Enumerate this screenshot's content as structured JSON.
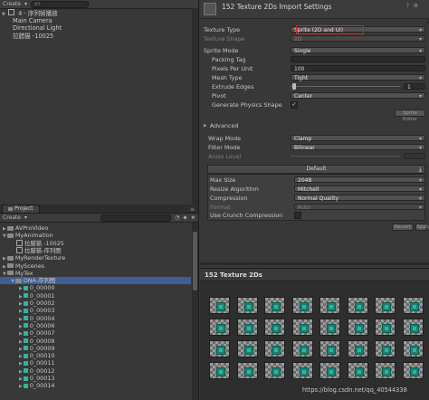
{
  "hierarchy": {
    "create_label": "Create",
    "search_placeholder": "All",
    "scene_name": "4 - 序列帧播放",
    "items": [
      "Main Camera",
      "Directional Light",
      "拉腊猫 -10025"
    ]
  },
  "project": {
    "tab_label": "Project",
    "create_label": "Create",
    "folders": [
      {
        "label": "AVProVideo",
        "indent": 0,
        "kind": "folder"
      },
      {
        "label": "MyAnimation",
        "indent": 0,
        "kind": "folder"
      },
      {
        "label": "拉腊猫 -10025",
        "indent": 1,
        "kind": "asset"
      },
      {
        "label": "拉腊猫-序列图",
        "indent": 1,
        "kind": "asset"
      },
      {
        "label": "MyRenderTexture",
        "indent": 0,
        "kind": "folder"
      },
      {
        "label": "MyScenes",
        "indent": 0,
        "kind": "folder"
      },
      {
        "label": "MyTex",
        "indent": 0,
        "kind": "folder"
      },
      {
        "label": "DNA-序列图",
        "indent": 1,
        "kind": "folder",
        "selected": true
      },
      {
        "label": "0_00000",
        "indent": 2,
        "kind": "sprite"
      },
      {
        "label": "0_00001",
        "indent": 2,
        "kind": "sprite"
      },
      {
        "label": "0_00002",
        "indent": 2,
        "kind": "sprite"
      },
      {
        "label": "0_00003",
        "indent": 2,
        "kind": "sprite"
      },
      {
        "label": "0_00004",
        "indent": 2,
        "kind": "sprite"
      },
      {
        "label": "0_00006",
        "indent": 2,
        "kind": "sprite"
      },
      {
        "label": "0_00007",
        "indent": 2,
        "kind": "sprite"
      },
      {
        "label": "0_00008",
        "indent": 2,
        "kind": "sprite"
      },
      {
        "label": "0_00009",
        "indent": 2,
        "kind": "sprite"
      },
      {
        "label": "0_00010",
        "indent": 2,
        "kind": "sprite"
      },
      {
        "label": "0_00011",
        "indent": 2,
        "kind": "sprite"
      },
      {
        "label": "0_00012",
        "indent": 2,
        "kind": "sprite"
      },
      {
        "label": "0_00013",
        "indent": 2,
        "kind": "sprite"
      },
      {
        "label": "0_00014",
        "indent": 2,
        "kind": "sprite"
      }
    ]
  },
  "inspector": {
    "title": "152 Texture 2Ds Import Settings",
    "texture_type_label": "Texture Type",
    "texture_type_value": "Sprite (2D and UI)",
    "texture_shape_label": "Texture Shape",
    "texture_shape_value": "2D",
    "sprite_mode_label": "Sprite Mode",
    "sprite_mode_value": "Single",
    "packing_tag_label": "Packing Tag",
    "packing_tag_value": "",
    "ppu_label": "Pixels Per Unit",
    "ppu_value": "100",
    "mesh_type_label": "Mesh Type",
    "mesh_type_value": "Tight",
    "extrude_label": "Extrude Edges",
    "extrude_value": "1",
    "pivot_label": "Pivot",
    "pivot_value": "Center",
    "physics_label": "Generate Physics Shape",
    "physics_checked": true,
    "sprite_editor_label": "Sprite Editor",
    "advanced_label": "Advanced",
    "wrap_label": "Wrap Mode",
    "wrap_value": "Clamp",
    "filter_label": "Filter Mode",
    "filter_value": "Bilinear",
    "aniso_label": "Aniso Level",
    "platform_tab": "Default",
    "max_size_label": "Max Size",
    "max_size_value": "2048",
    "resize_label": "Resize Algorithm",
    "resize_value": "Mitchell",
    "compression_label": "Compression",
    "compression_value": "Normal Quality",
    "format_label": "Format",
    "format_value": "Auto",
    "crunch_label": "Use Crunch Compression",
    "crunch_checked": false,
    "revert_label": "Revert",
    "apply_label": "Apply"
  },
  "preview": {
    "title": "152 Texture 2Ds"
  },
  "watermark": "https://blog.csdn.net/qq_40544338",
  "colors": {
    "selection": "#3e5f96",
    "highlight_box": "#e02020",
    "sprite_teal": "#2db69e"
  }
}
